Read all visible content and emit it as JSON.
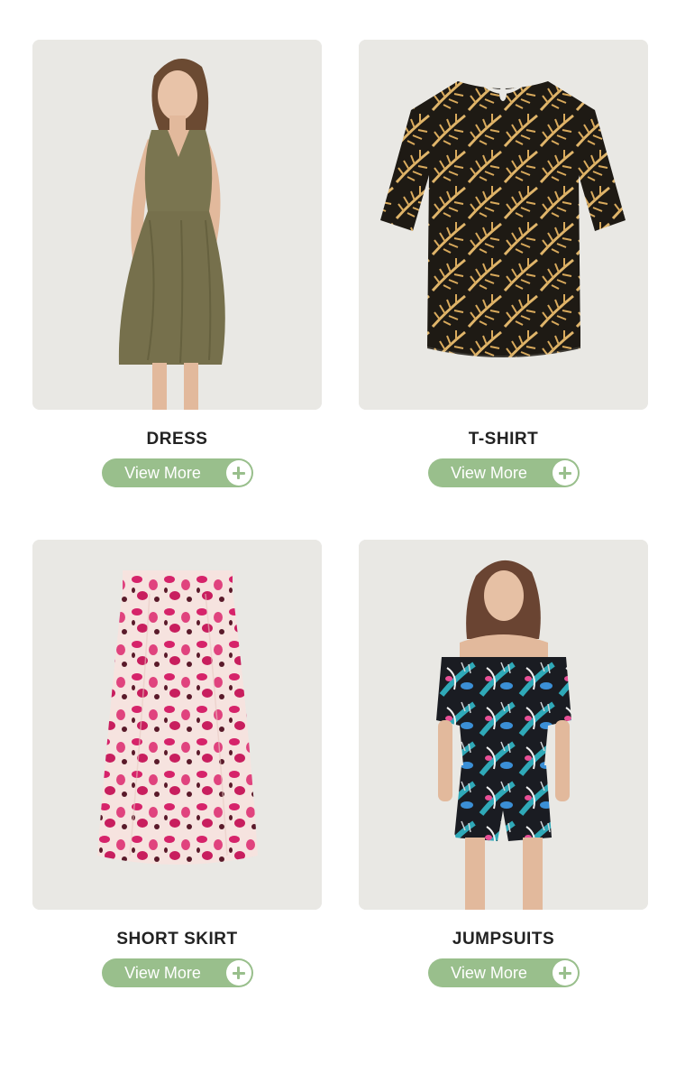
{
  "products": [
    {
      "title": "DRESS",
      "button_label": "View More",
      "image": "woman-in-olive-wrap-dress"
    },
    {
      "title": "T-SHIRT",
      "button_label": "View More",
      "image": "palm-print-tshirt"
    },
    {
      "title": "SHORT SKIRT",
      "button_label": "View More",
      "image": "pink-leopard-print-skirt"
    },
    {
      "title": "JUMPSUITS",
      "button_label": "View More",
      "image": "woman-in-tropical-print-romper"
    }
  ],
  "colors": {
    "button_bg": "#99bf8c",
    "button_text": "#ffffff",
    "title_text": "#222222",
    "photo_bg": "#e9e8e4"
  },
  "icons": {
    "button_icon": "plus-circle-icon"
  }
}
